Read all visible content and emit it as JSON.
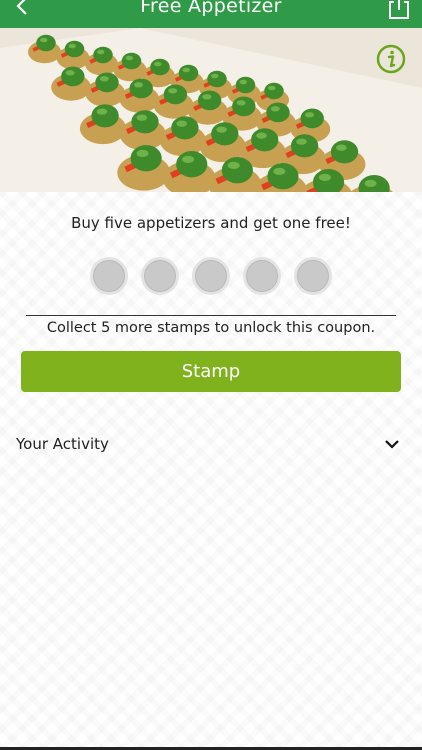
{
  "nav": {
    "title": "Free Appetizer",
    "back_icon": "chevron-left-icon",
    "share_icon": "share-icon",
    "bar_color": "#2f9a47"
  },
  "hero": {
    "info_icon": "info-icon",
    "image_desc": "appetizer-platter-photo"
  },
  "coupon": {
    "promo_text": "Buy five appetizers and get one free!",
    "stamps_total": 5,
    "stamps_collected": 0,
    "status_text": "Collect 5 more stamps to unlock this coupon.",
    "stamp_button_label": "Stamp",
    "accent_color": "#80b21e"
  },
  "activity": {
    "label": "Your Activity",
    "toggle_icon": "chevron-down-icon"
  }
}
